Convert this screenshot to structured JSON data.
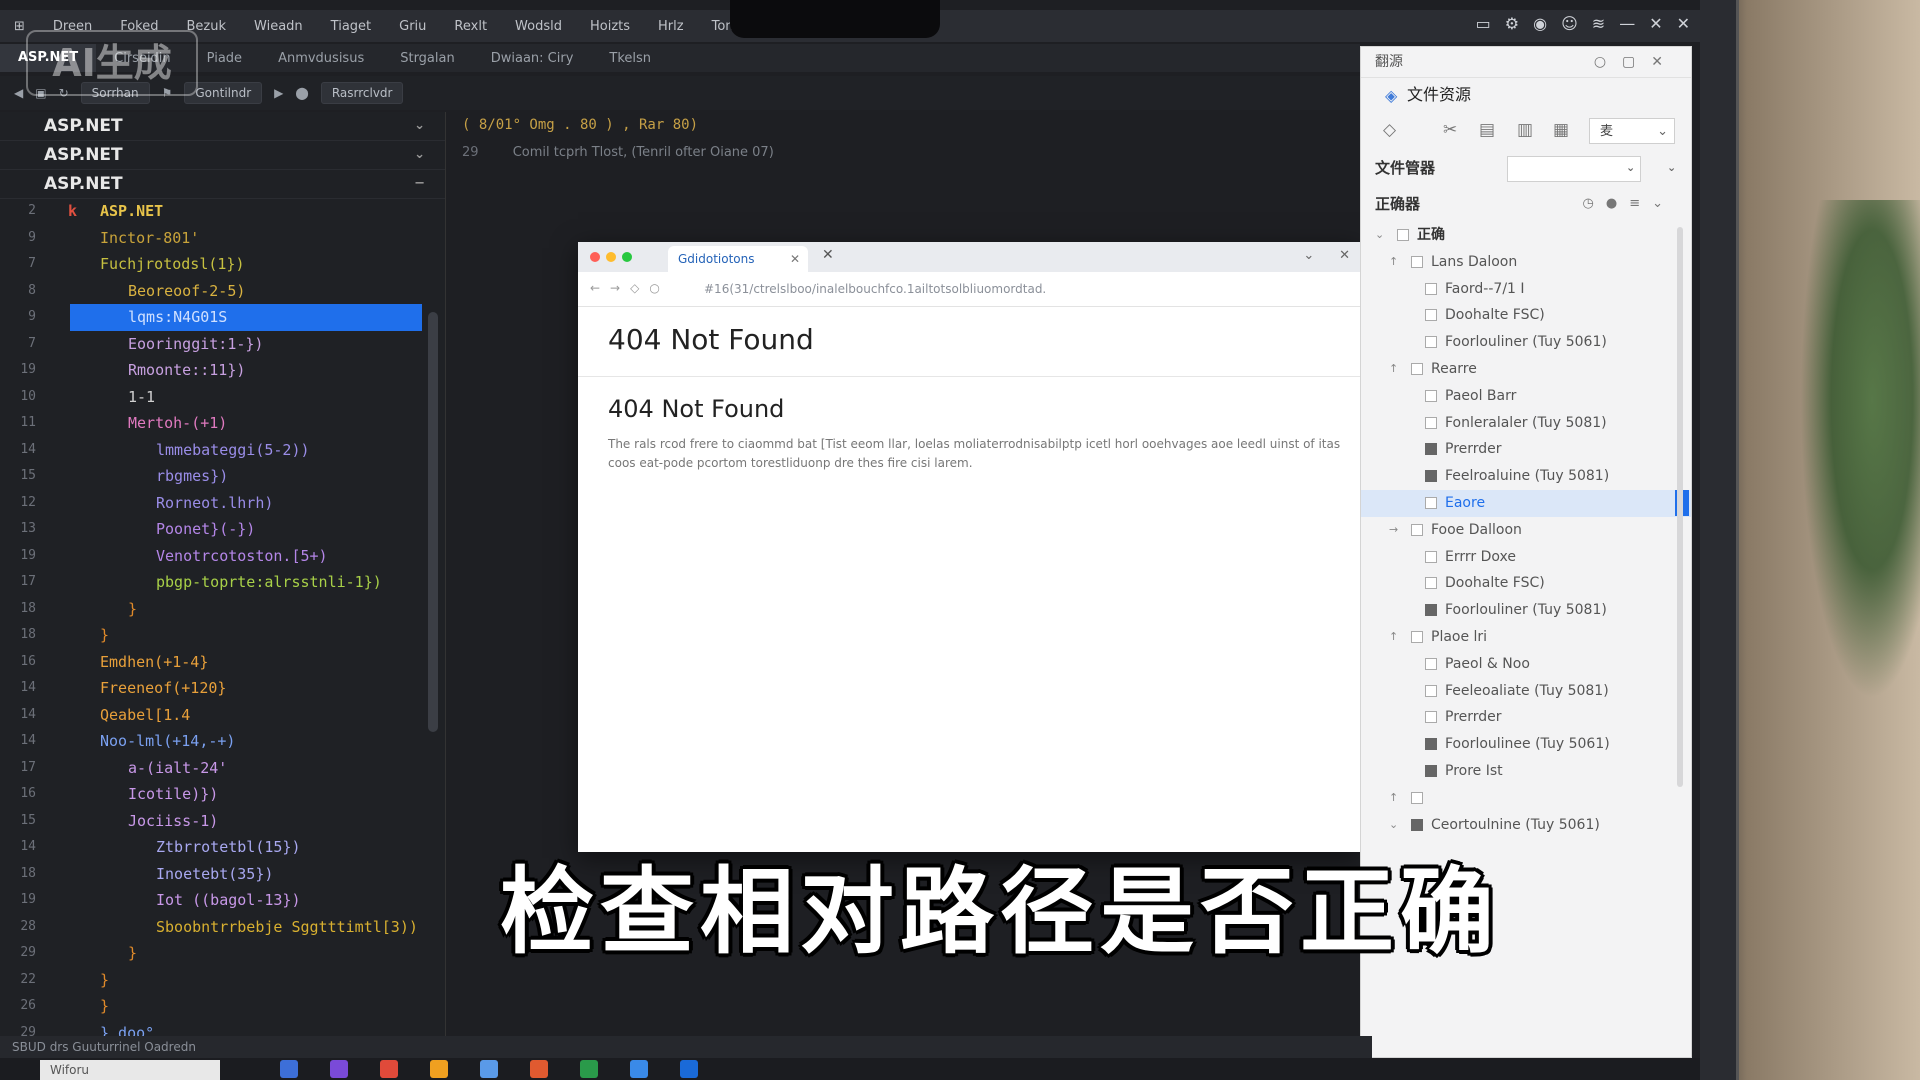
{
  "watermark": "AI生成",
  "menubar": {
    "items": [
      "Dreen",
      "Foked",
      "Bezuk",
      "Wieadn",
      "Tiaget",
      "Griu",
      "Rexlt",
      "Wodsld",
      "Hoizts",
      "Hrlz",
      "Tonzim"
    ]
  },
  "tabs": [
    "ASP.NET",
    "Cirseidin",
    "Piade",
    "Anmvdusisus",
    "Strgalan",
    "Dwiaan: Ciry",
    "Tkelsn"
  ],
  "toolbar": {
    "search_label": "Sorrhan",
    "config": "Gontilndr",
    "dropdown_label": "Rasrrclvdr"
  },
  "explorer": {
    "crumbs": [
      "ASP.NET",
      "ASP.NET",
      "ASP.NET"
    ],
    "project_root": "ASP.NET"
  },
  "code_lines": [
    {
      "n": "2",
      "text": "ASP.NET",
      "color": "#e8c44a",
      "indent": 0,
      "icon": "k"
    },
    {
      "n": "9",
      "text": "Inctor-801'",
      "color": "#c8a33a",
      "indent": 0
    },
    {
      "n": "7",
      "text": "Fuchjrotodsl(1})",
      "color": "#c6c040",
      "indent": 0
    },
    {
      "n": "8",
      "text": "Beoreoof-2-5)",
      "color": "#d9b240",
      "indent": 1
    },
    {
      "n": "9",
      "text": "lqms:N4G01S",
      "color": "#cfe0ff",
      "indent": 1,
      "selected": true
    },
    {
      "n": "7",
      "text": "Eooringgit:1-})",
      "color": "#c7a0e0",
      "indent": 1
    },
    {
      "n": "19",
      "text": "Rmoonte::11})",
      "color": "#c7a0e0",
      "indent": 1
    },
    {
      "n": "10",
      "text": "1-1",
      "color": "#d0d0d0",
      "indent": 1
    },
    {
      "n": "11",
      "text": "Mertoh-(+1)",
      "color": "#e07ac0",
      "indent": 1
    },
    {
      "n": "14",
      "text": "lmmebateggi(5-2))",
      "color": "#9a8de8",
      "indent": 2
    },
    {
      "n": "15",
      "text": "rbgmes})",
      "color": "#9a8de8",
      "indent": 2
    },
    {
      "n": "12",
      "text": "Rorneot.lhrh)",
      "color": "#9a8de8",
      "indent": 2
    },
    {
      "n": "13",
      "text": "Poonet}(-})",
      "color": "#b486e8",
      "indent": 2
    },
    {
      "n": "19",
      "text": "Venotrcotoston.[5+)",
      "color": "#b486e8",
      "indent": 2
    },
    {
      "n": "17",
      "text": "pbgp-toprte:alrsstnli-1})",
      "color": "#a8d048",
      "indent": 2
    },
    {
      "n": "18",
      "text": "}",
      "color": "#e08a2a",
      "indent": 1
    },
    {
      "n": "18",
      "text": "}",
      "color": "#e08a2a",
      "indent": 0
    },
    {
      "n": "16",
      "text": "Emdhen(+1-4}",
      "color": "#e8a03a",
      "indent": 0
    },
    {
      "n": "14",
      "text": "Freeneof(+120}",
      "color": "#e8a03a",
      "indent": 0
    },
    {
      "n": "14",
      "text": "Qeabel[1.4",
      "color": "#e8a03a",
      "indent": 0
    },
    {
      "n": "14",
      "text": "Noo-lml(+14,-+)",
      "color": "#7aa0f0",
      "indent": 0
    },
    {
      "n": "17",
      "text": "a-(ialt-24'",
      "color": "#c898e8",
      "indent": 1
    },
    {
      "n": "16",
      "text": "Icotile)})",
      "color": "#c898e8",
      "indent": 1
    },
    {
      "n": "15",
      "text": "Jociiss-1)",
      "color": "#c898e8",
      "indent": 1
    },
    {
      "n": "14",
      "text": "Ztbrrotetbl(15})",
      "color": "#a8a8f0",
      "indent": 2
    },
    {
      "n": "18",
      "text": "Inoetebt(35})",
      "color": "#a8a8f0",
      "indent": 2
    },
    {
      "n": "19",
      "text": "Iot ((bagol-13})",
      "color": "#c898e8",
      "indent": 2
    },
    {
      "n": "28",
      "text": "Sboobntrrbebje Sggtttimtl[3))",
      "color": "#d8b030",
      "indent": 2
    },
    {
      "n": "29",
      "text": "}",
      "color": "#e08a2a",
      "indent": 1
    },
    {
      "n": "22",
      "text": "}",
      "color": "#e08a2a",
      "indent": 0
    },
    {
      "n": "26",
      "text": "}",
      "color": "#e08a2a",
      "indent": 0
    },
    {
      "n": "29",
      "text": "} doo°",
      "color": "#7aa0f0",
      "indent": 0
    }
  ],
  "editor": {
    "header": "( 8/01°   Omg . 80 ) , Rar 80)",
    "line_no": "29",
    "sub": "Comil tcprh Tlost, (Tenril ofter Oiane 07)"
  },
  "browser": {
    "tab_label": "Gdidotiotons",
    "url": "#16(31/ctrelslboo/inalelbouchfco.1ailtotsolbliuomordtad.",
    "h1": "404 Not Found",
    "h2": "404 Not Found",
    "para": "The rals rcod frere to ciaommd bat [Tist eeom llar, loelas moliaterrodnisabilptp icetl horl ooehvages aoe leedl uinst of itas coos eat-pode pcortom torestliduonp dre thes fire cisi larem."
  },
  "right_panel": {
    "title": "翻源",
    "header": "文件资源",
    "tool_select": "麦",
    "filter_label": "文件管器",
    "work_label": "正确器",
    "tree": [
      {
        "label": "正确",
        "level": 0,
        "root": true,
        "arrow": "⌄",
        "checked": false
      },
      {
        "label": "Lans Daloon",
        "level": 1,
        "arrow": "↑",
        "checked": false
      },
      {
        "label": "Faord--7/1 I",
        "level": 2,
        "checked": false
      },
      {
        "label": "Doohalte FSC)",
        "level": 2,
        "checked": false
      },
      {
        "label": "Foorlouliner (Tuy 5061)",
        "level": 2,
        "checked": false
      },
      {
        "label": "Rearre",
        "level": 1,
        "arrow": "↑",
        "checked": false
      },
      {
        "label": "Paeol Barr",
        "level": 2,
        "checked": false
      },
      {
        "label": "Fonleralaler (Tuy 5081)",
        "level": 2,
        "checked": false
      },
      {
        "label": "Prerrder",
        "level": 2,
        "checked": true
      },
      {
        "label": "Feelroaluine (Tuy 5081)",
        "level": 2,
        "checked": true
      },
      {
        "label": "Eaore",
        "level": 2,
        "checked": false,
        "selected": true
      },
      {
        "label": "Fooe Dalloon",
        "level": 1,
        "arrow": "→",
        "checked": false
      },
      {
        "label": "Errrr Doxe",
        "level": 2,
        "checked": false
      },
      {
        "label": "Doohalte FSC)",
        "level": 2,
        "checked": false
      },
      {
        "label": "Foorlouliner (Tuy 5081)",
        "level": 2,
        "checked": true
      },
      {
        "label": "Plaoe lri",
        "level": 1,
        "arrow": "↑",
        "checked": false
      },
      {
        "label": "Paeol & Noo",
        "level": 2,
        "checked": false
      },
      {
        "label": "Feeleoaliate (Tuy 5081)",
        "level": 2,
        "checked": false
      },
      {
        "label": "Prerrder",
        "level": 2,
        "checked": false
      },
      {
        "label": "Foorloulinee (Tuy 5061)",
        "level": 2,
        "checked": true
      },
      {
        "label": "Prore Ist",
        "level": 2,
        "checked": true
      },
      {
        "label": "",
        "level": 1,
        "arrow": "↑",
        "checked": false
      },
      {
        "label": "Ceortoulnine (Tuy 5061)",
        "level": 1,
        "arrow": "⌄",
        "checked": true
      }
    ]
  },
  "status": "SBUD drs   Guuturrinel  Oadredn",
  "taskbar": {
    "search": "Wiforu"
  },
  "subtitle": "检查相对路径是否正确"
}
